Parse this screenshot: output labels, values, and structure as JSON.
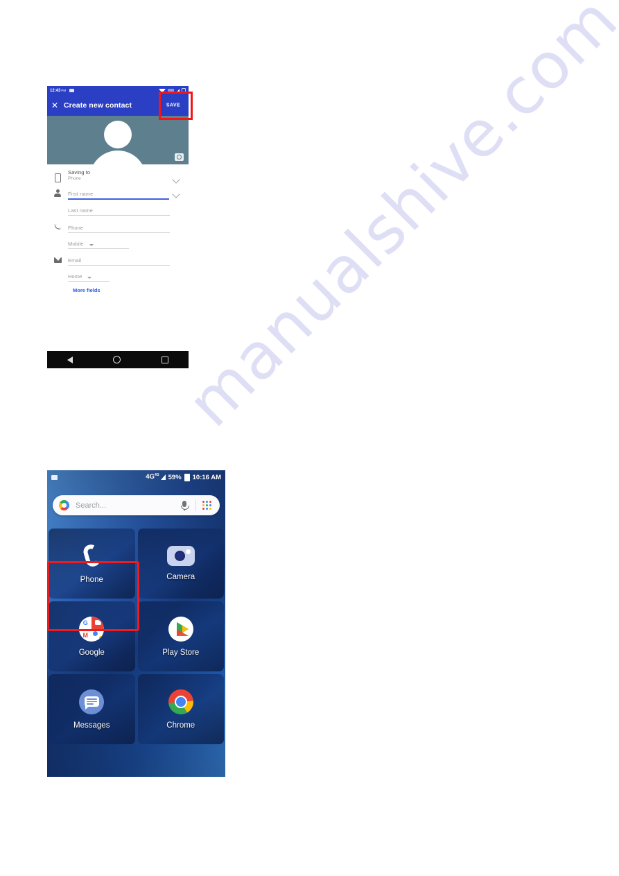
{
  "watermark": {
    "text": "manualshive.com"
  },
  "screenshot_contacts": {
    "status_bar": {
      "time": "12:43",
      "ampm": "PM",
      "icons": [
        "gallery-icon",
        "wifi-icon",
        "sim-icon",
        "signal-icon",
        "battery-icon"
      ]
    },
    "app_bar": {
      "close_label": "✕",
      "title": "Create new contact",
      "save_label": "SAVE"
    },
    "avatar": {
      "camera_icon": "camera-icon"
    },
    "fields": [
      {
        "icon": "phone-device-icon",
        "label": "Saving to",
        "sub": "Phone",
        "trailing": "chevron-down-icon",
        "state": "value"
      },
      {
        "icon": "person-icon",
        "label": "First name",
        "trailing": "chevron-down-icon",
        "state": "focused"
      },
      {
        "icon": "",
        "label": "Last name",
        "trailing": "",
        "state": "empty"
      },
      {
        "icon": "call-icon",
        "label": "Phone",
        "trailing": "",
        "state": "empty"
      },
      {
        "icon": "",
        "label": "Mobile",
        "trailing": "caret-down-icon",
        "state": "dropdown"
      },
      {
        "icon": "mail-icon",
        "label": "Email",
        "trailing": "",
        "state": "empty"
      },
      {
        "icon": "",
        "label": "Home",
        "trailing": "caret-down-icon",
        "state": "dropdown"
      }
    ],
    "more_fields_label": "More fields",
    "nav_bar": [
      "back-icon",
      "home-icon",
      "recents-icon"
    ],
    "colors": {
      "app_bar": "#2b3fc4",
      "avatar_bg": "#5d7f8e",
      "link": "#2a5bd7",
      "highlight": "#f31616"
    }
  },
  "screenshot_home": {
    "status_bar": {
      "left_icon": "gallery-icon",
      "network": "4G",
      "network_sup": "4G",
      "battery": "59%",
      "time": "10:16 AM"
    },
    "search": {
      "logo": "google-g-icon",
      "placeholder": "Search...",
      "mic_icon": "microphone-icon",
      "apps_icon": "app-drawer-icon"
    },
    "apps": [
      {
        "label": "Phone",
        "icon": "phone-icon",
        "highlighted": true
      },
      {
        "label": "Camera",
        "icon": "camera-icon",
        "highlighted": false
      },
      {
        "label": "Google",
        "icon": "google-folder-icon",
        "highlighted": false
      },
      {
        "label": "Play Store",
        "icon": "play-store-icon",
        "highlighted": false
      },
      {
        "label": "Messages",
        "icon": "messages-icon",
        "highlighted": false
      },
      {
        "label": "Chrome",
        "icon": "chrome-icon",
        "highlighted": false
      }
    ],
    "colors": {
      "highlight": "#f21b1b"
    }
  }
}
